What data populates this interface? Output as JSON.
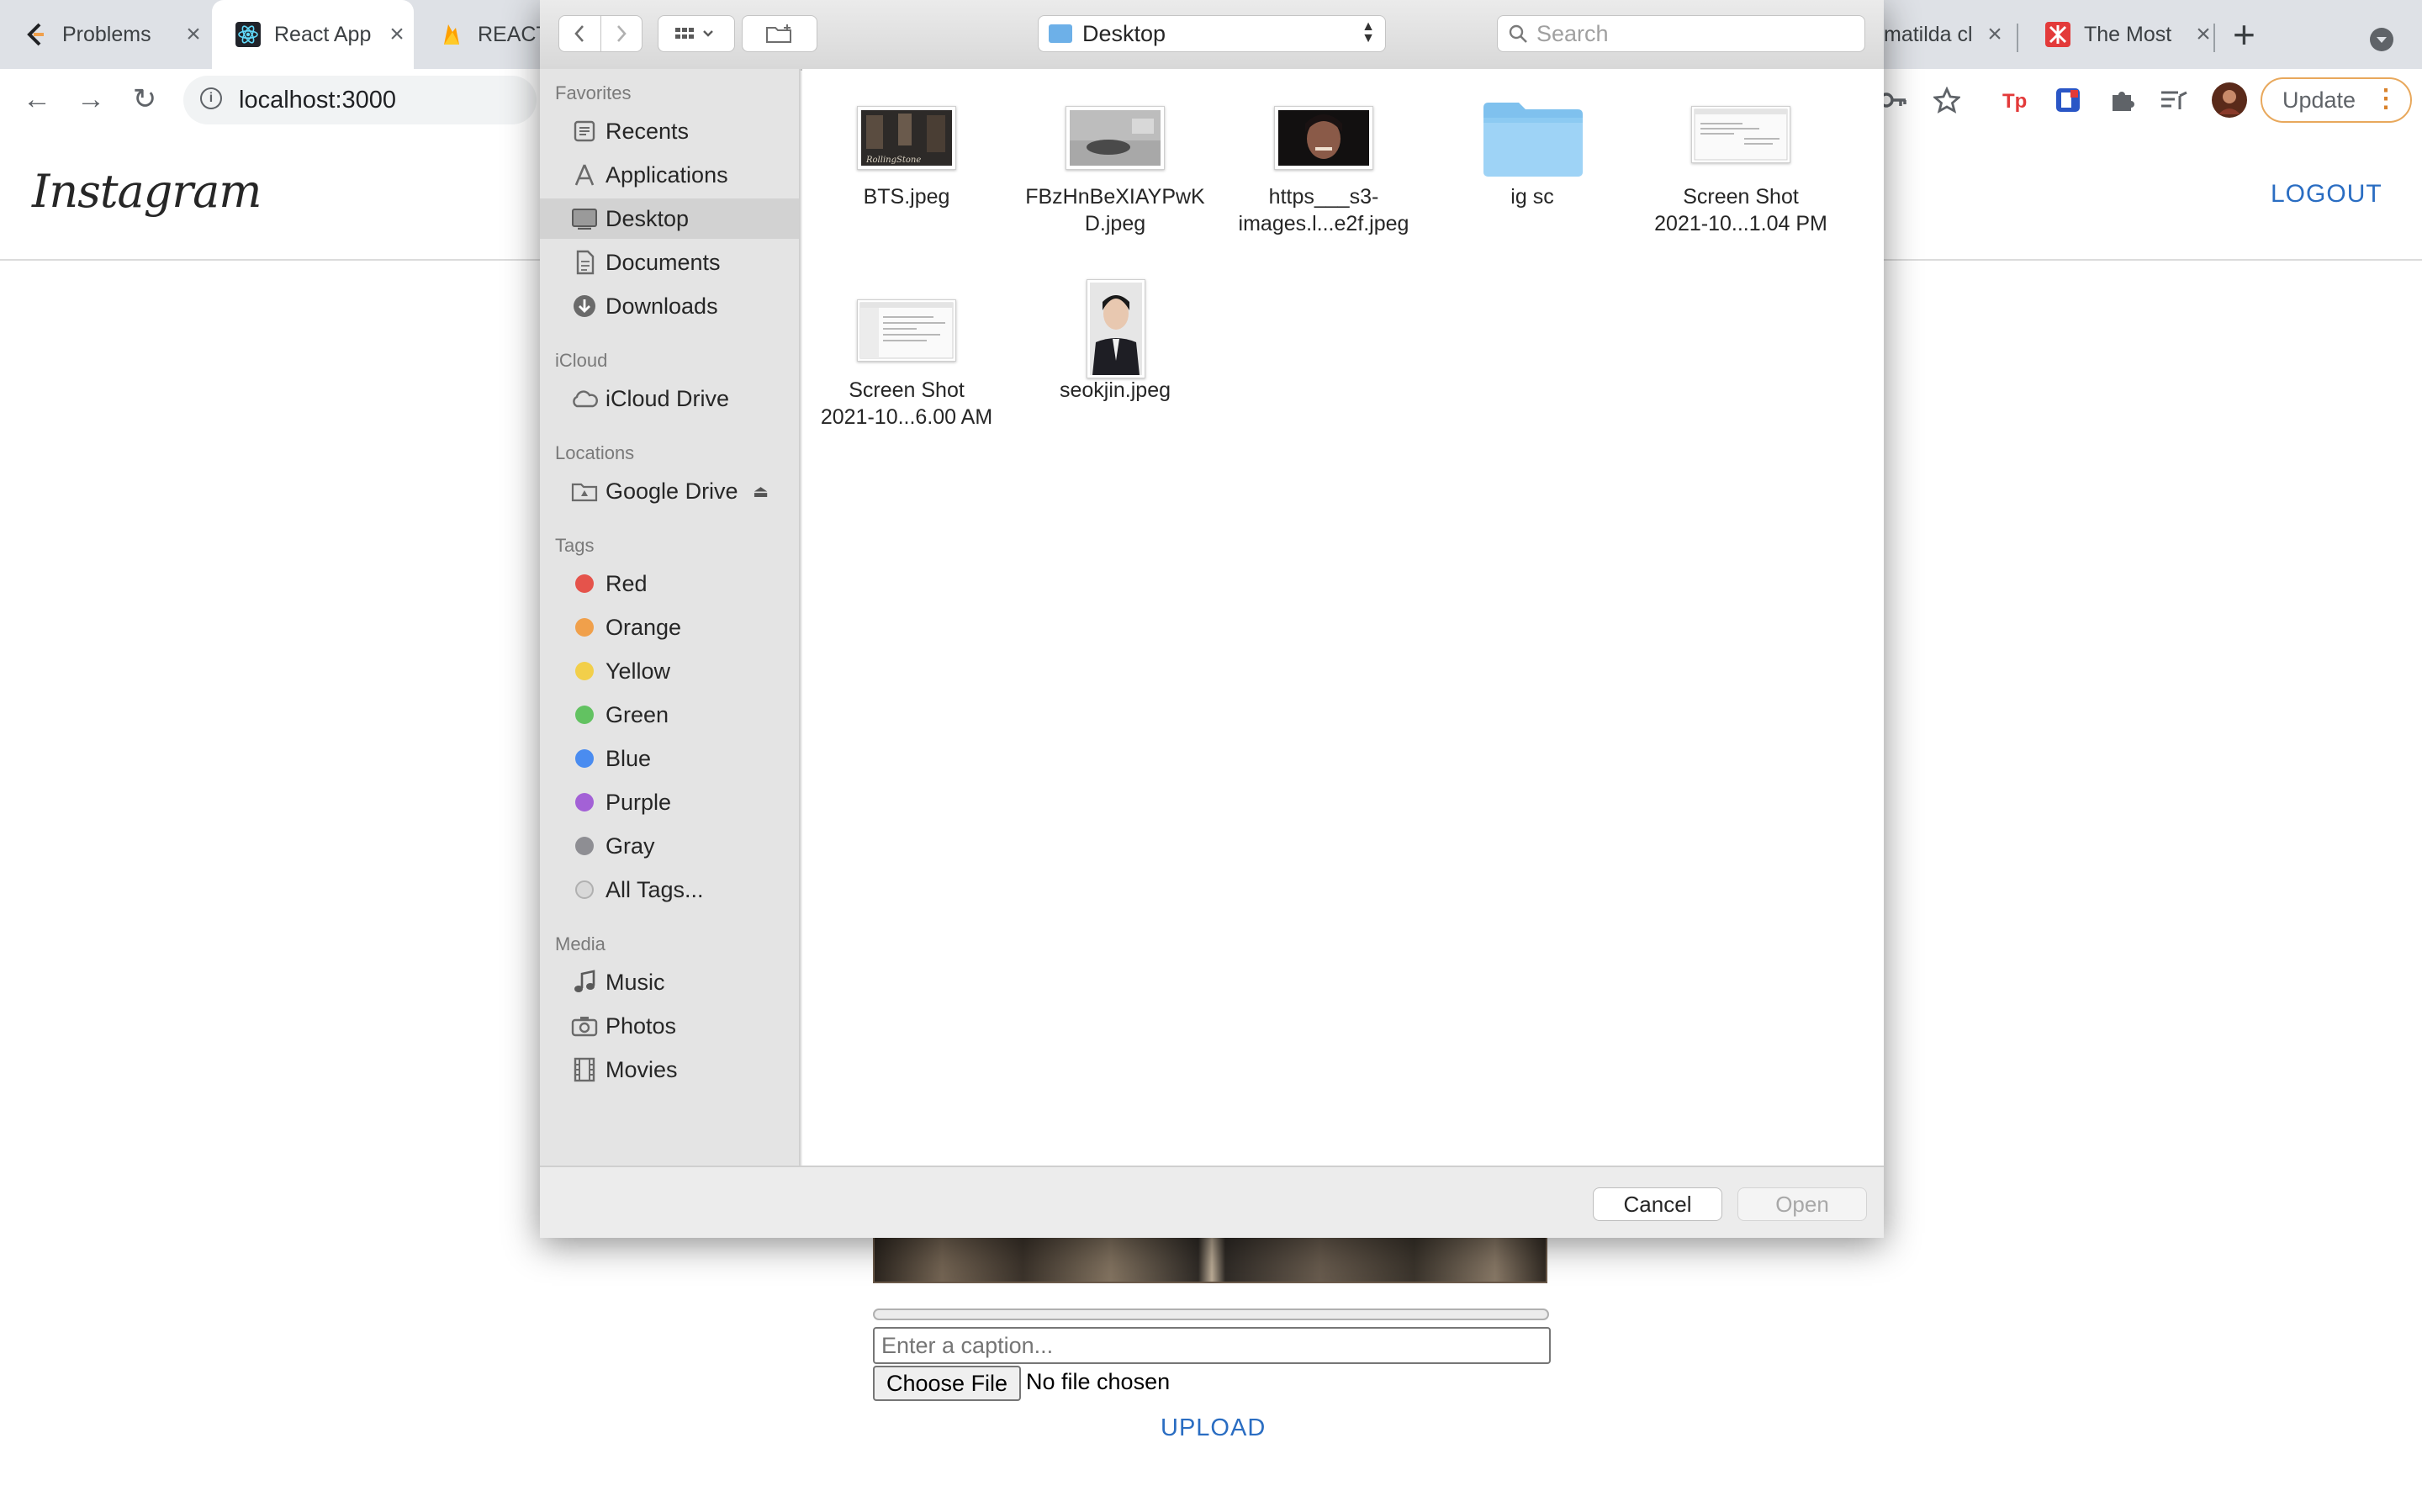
{
  "browser": {
    "tabs": [
      {
        "title": "Problems"
      },
      {
        "title": "React App"
      },
      {
        "title": "REACT"
      },
      {
        "title": "matilda cl"
      },
      {
        "title": "The Most"
      }
    ],
    "new_tab": "+",
    "url": "localhost:3000",
    "update_label": "Update"
  },
  "page": {
    "logo": "Instagram",
    "logout": "LOGOUT",
    "caption_placeholder": "Enter a caption...",
    "choose_file": "Choose File",
    "no_file": "No file chosen",
    "upload": "UPLOAD"
  },
  "dialog": {
    "location": "Desktop",
    "search_placeholder": "Search",
    "sections": {
      "favorites": "Favorites",
      "icloud": "iCloud",
      "locations": "Locations",
      "tags": "Tags",
      "media": "Media"
    },
    "favorites": [
      {
        "label": "Recents",
        "icon": "recents-icon"
      },
      {
        "label": "Applications",
        "icon": "applications-icon"
      },
      {
        "label": "Desktop",
        "icon": "desktop-icon",
        "selected": true
      },
      {
        "label": "Documents",
        "icon": "documents-icon"
      },
      {
        "label": "Downloads",
        "icon": "downloads-icon"
      }
    ],
    "icloud": [
      {
        "label": "iCloud Drive",
        "icon": "cloud-icon"
      }
    ],
    "locations": [
      {
        "label": "Google Drive",
        "icon": "drive-icon"
      }
    ],
    "tags": [
      {
        "label": "Red",
        "color": "#e5534b"
      },
      {
        "label": "Orange",
        "color": "#f0a04b"
      },
      {
        "label": "Yellow",
        "color": "#f2cf4a"
      },
      {
        "label": "Green",
        "color": "#62c261"
      },
      {
        "label": "Blue",
        "color": "#4a8cf0"
      },
      {
        "label": "Purple",
        "color": "#a361d6"
      },
      {
        "label": "Gray",
        "color": "#8e8e93"
      },
      {
        "label": "All Tags...",
        "color": "#d0d0d0"
      }
    ],
    "media": [
      {
        "label": "Music",
        "icon": "music-icon"
      },
      {
        "label": "Photos",
        "icon": "camera-icon"
      },
      {
        "label": "Movies",
        "icon": "film-icon"
      }
    ],
    "files": [
      {
        "name_lines": [
          "BTS.jpeg"
        ],
        "kind": "photo-dark"
      },
      {
        "name_lines": [
          "FBzHnBeXIAYPwK",
          "D.jpeg"
        ],
        "kind": "photo-gray"
      },
      {
        "name_lines": [
          "https___s3-",
          "images.l...e2f.jpeg"
        ],
        "kind": "photo-face"
      },
      {
        "name_lines": [
          "ig sc"
        ],
        "kind": "folder"
      },
      {
        "name_lines": [
          "Screen Shot",
          "2021-10...1.04 PM"
        ],
        "kind": "screenshot"
      },
      {
        "name_lines": [
          "Screen Shot",
          "2021-10...6.00 AM"
        ],
        "kind": "screenshot"
      },
      {
        "name_lines": [
          "seokjin.jpeg"
        ],
        "kind": "portrait"
      }
    ],
    "cancel": "Cancel",
    "open": "Open"
  }
}
